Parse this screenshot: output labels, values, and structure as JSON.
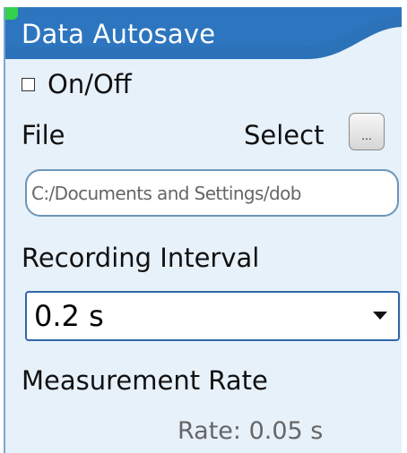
{
  "panel": {
    "title": "Data Autosave",
    "header_color": "#2b72b8",
    "background_color": "#e7f1fa"
  },
  "autosave": {
    "toggle_label": "On/Off",
    "checked": false
  },
  "file": {
    "label": "File",
    "select_label": "Select",
    "button_label": "...",
    "path": "C:/Documents and Settings/dob"
  },
  "recording": {
    "label": "Recording Interval",
    "value": "0.2 s"
  },
  "measurement": {
    "label": "Measurement Rate",
    "rate_text": "Rate: 0.05 s"
  },
  "icons": {
    "checkbox": "checkbox-icon",
    "dropdown": "chevron-down-icon",
    "file_browse": "ellipsis-icon"
  }
}
